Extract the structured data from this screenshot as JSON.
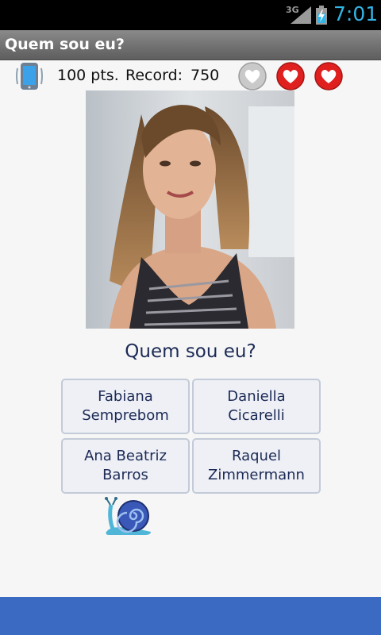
{
  "status_bar": {
    "network": "3G",
    "time": "7:01",
    "time_color": "#33b5e5"
  },
  "app": {
    "title": "Quem sou eu?"
  },
  "score": {
    "points": "100 pts.",
    "record_label": "Record:",
    "record_value": "750",
    "lives_total": 3,
    "lives_remaining": 2
  },
  "photo": {
    "icon": "person-photo"
  },
  "question": "Quem sou eu?",
  "answers": [
    {
      "label": "Fabiana Semprebom"
    },
    {
      "label": "Daniella Cicarelli"
    },
    {
      "label": "Ana Beatriz Barros"
    },
    {
      "label": "Raquel Zimmermann"
    }
  ],
  "colors": {
    "footer": "#3a6ac1",
    "heart_active": "#e0201e",
    "heart_lost": "#b5b5b5"
  }
}
